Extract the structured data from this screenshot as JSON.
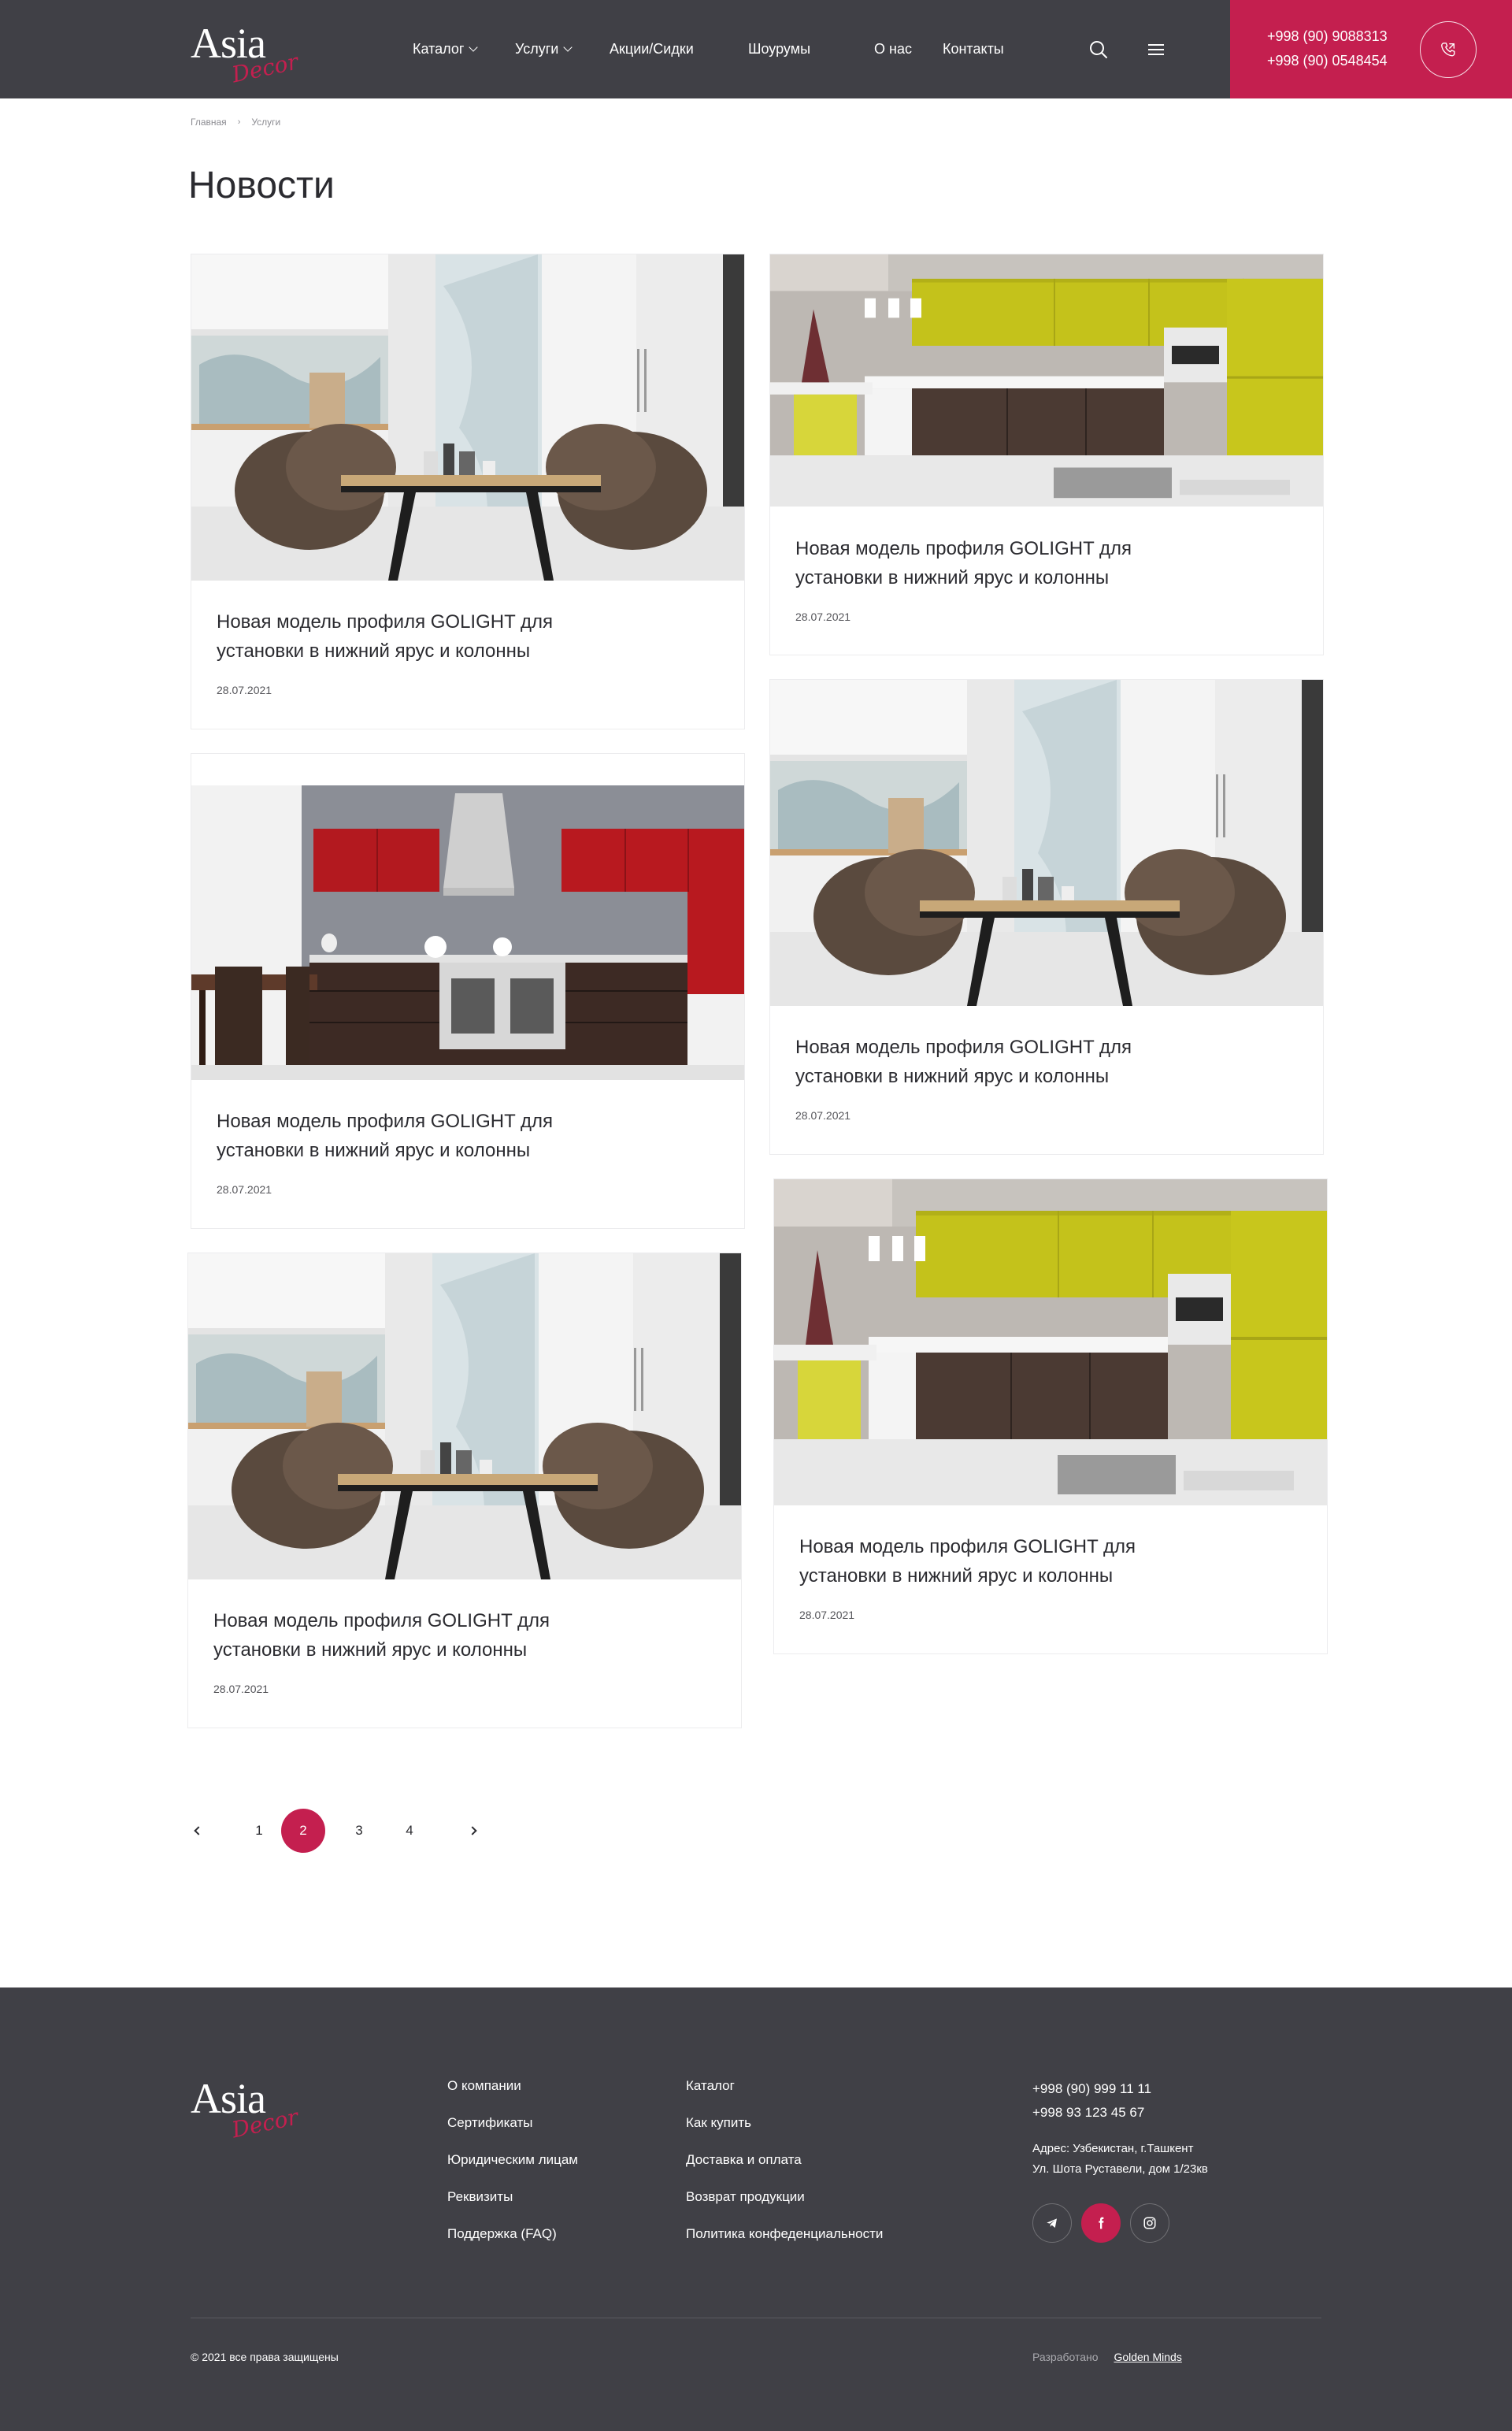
{
  "header": {
    "logo": {
      "word": "Asia",
      "script": "Decor"
    },
    "nav": [
      {
        "label": "Каталог",
        "dropdown": true
      },
      {
        "label": "Услуги",
        "dropdown": true
      },
      {
        "label": "Акции/Сидки",
        "dropdown": false
      },
      {
        "label": "Шоурумы",
        "dropdown": false
      },
      {
        "label": "О нас",
        "dropdown": false
      },
      {
        "label": "Контакты",
        "dropdown": false
      }
    ],
    "icons": [
      "search-icon",
      "menu-icon",
      "phone-call-icon"
    ],
    "phones": [
      "+998 (90) 9088313",
      "+998 (90) 0548454"
    ]
  },
  "breadcrumb": [
    "Главная",
    "Услуги"
  ],
  "page_title": "Новости",
  "news": [
    {
      "title": "Новая модель профиля GOLIGHT для установки в нижний ярус и колонны",
      "date": "28.07.2021",
      "image": "dining-room"
    },
    {
      "title": "Новая модель профиля GOLIGHT для установки в нижний ярус и колонны",
      "date": "28.07.2021",
      "image": "yellow-kitchen"
    },
    {
      "title": "Новая модель профиля GOLIGHT для установки в нижний ярус и колонны",
      "date": "28.07.2021",
      "image": "red-kitchen"
    },
    {
      "title": "Новая модель профиля GOLIGHT для установки в нижний ярус и колонны",
      "date": "28.07.2021",
      "image": "dining-room"
    },
    {
      "title": "Новая модель профиля GOLIGHT для установки в нижний ярус и колонны",
      "date": "28.07.2021",
      "image": "dining-room"
    },
    {
      "title": "Новая модель профиля GOLIGHT для установки в нижний ярус и колонны",
      "date": "28.07.2021",
      "image": "yellow-kitchen"
    }
  ],
  "pagination": {
    "pages": [
      "1",
      "2",
      "3",
      "4"
    ],
    "current": "2"
  },
  "footer": {
    "col1": [
      "О компании",
      "Сертификаты",
      "Юридическим лицам",
      "Реквизиты",
      "Поддержка (FAQ)"
    ],
    "col2": [
      "Каталог",
      "Как купить",
      "Доставка и оплата",
      "Возврат продукции",
      "Политика конфеденциальности"
    ],
    "phones": [
      "+998 (90) 999 11 11",
      "+998 93 123 45 67"
    ],
    "address": [
      "Адрес: Узбекистан, г.Ташкент",
      "Ул. Шота Руставели, дом 1/23кв"
    ],
    "socials": [
      "telegram-icon",
      "facebook-icon",
      "instagram-icon"
    ],
    "copyright": "© 2021 все права защищены",
    "developed_label": "Разработано",
    "developer": "Golden Minds"
  },
  "colors": {
    "brand": "#c41f4f",
    "dark": "#404046",
    "text": "#2b2b30"
  }
}
